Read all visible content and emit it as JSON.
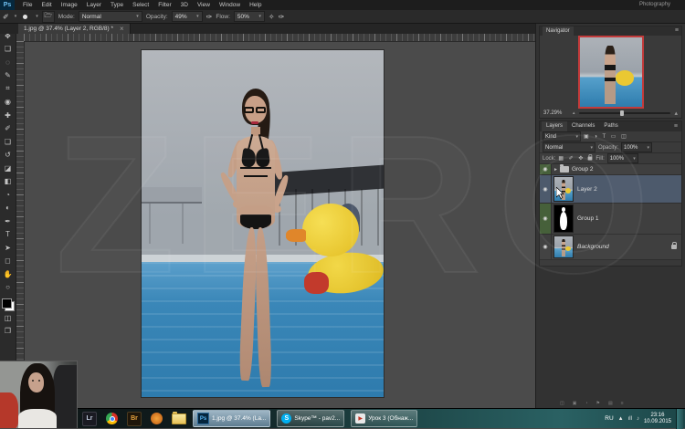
{
  "app": {
    "logo": "Ps",
    "workspace": "Photography"
  },
  "menu": [
    "File",
    "Edit",
    "Image",
    "Layer",
    "Type",
    "Select",
    "Filter",
    "3D",
    "View",
    "Window",
    "Help"
  ],
  "options": {
    "mode_label": "Mode:",
    "mode_value": "Normal",
    "opacity_label": "Opacity:",
    "opacity_value": "49%",
    "flow_label": "Flow:",
    "flow_value": "50%"
  },
  "document": {
    "tab_title": "1.jpg @ 37.4% (Layer 2, RGB/8) *",
    "close_glyph": "×"
  },
  "tools": [
    {
      "name": "move",
      "glyph": "✥"
    },
    {
      "name": "marquee",
      "glyph": "❑"
    },
    {
      "name": "lasso",
      "glyph": "◌"
    },
    {
      "name": "quick-selection",
      "glyph": "✎"
    },
    {
      "name": "crop",
      "glyph": "⌗"
    },
    {
      "name": "eyedropper",
      "glyph": "◉"
    },
    {
      "name": "healing-brush",
      "glyph": "✚"
    },
    {
      "name": "brush",
      "glyph": "✐"
    },
    {
      "name": "clone-stamp",
      "glyph": "❏"
    },
    {
      "name": "history-brush",
      "glyph": "↺"
    },
    {
      "name": "eraser",
      "glyph": "◪"
    },
    {
      "name": "gradient",
      "glyph": "◧"
    },
    {
      "name": "blur",
      "glyph": "◔"
    },
    {
      "name": "dodge",
      "glyph": "◐"
    },
    {
      "name": "pen",
      "glyph": "✒"
    },
    {
      "name": "type",
      "glyph": "T"
    },
    {
      "name": "path-selection",
      "glyph": "➤"
    },
    {
      "name": "shape",
      "glyph": "◻"
    },
    {
      "name": "hand",
      "glyph": "✋"
    },
    {
      "name": "zoom",
      "glyph": "○"
    }
  ],
  "tool_modes": {
    "quick_mask": "◫",
    "screen_mode": "❐"
  },
  "navigator": {
    "tab": "Navigator",
    "zoom_value": "37.29%",
    "menu_glyph": "≡"
  },
  "layers": {
    "tabs": [
      "Layers",
      "Channels",
      "Paths"
    ],
    "menu_glyph": "≡",
    "filter_label": "Kind",
    "filter_icons": "▣ ◑ T ▭ ◫",
    "blend_mode": "Normal",
    "opacity_label": "Opacity:",
    "opacity_value": "100%",
    "lock_label": "Lock:",
    "lock_icons": "▦ ✐ ✥",
    "fill_label": "Fill:",
    "fill_value": "100%",
    "rows": [
      {
        "name": "Group 2"
      },
      {
        "name": "Layer 2"
      },
      {
        "name": "Group 1"
      },
      {
        "name": "Background"
      }
    ]
  },
  "taskbar": {
    "lightroom_glyph": "Lr",
    "bridge_glyph": "Br",
    "ps_button": {
      "icon": "Ps",
      "label": "1.jpg @ 37.4% (La..."
    },
    "skype_button": {
      "icon": "S",
      "label": "Skype™ - pav2..."
    },
    "lesson_button": {
      "icon": "▶",
      "label": "Урок 3 (Обнаж..."
    },
    "tray": {
      "hidden_glyph": "▲",
      "lang": "RU",
      "net_glyph": "ıll",
      "sound_glyph": "♪",
      "time": "23:16",
      "date": "10.09.2015"
    }
  },
  "watermark": "ZERO",
  "colors": {
    "selection_blue": "#4d5a6c",
    "label_green": "#46603a",
    "navigator_border": "#cc3b3b",
    "taskbar_teal": "#2a6163",
    "accent_blue": "#57b4f2"
  }
}
